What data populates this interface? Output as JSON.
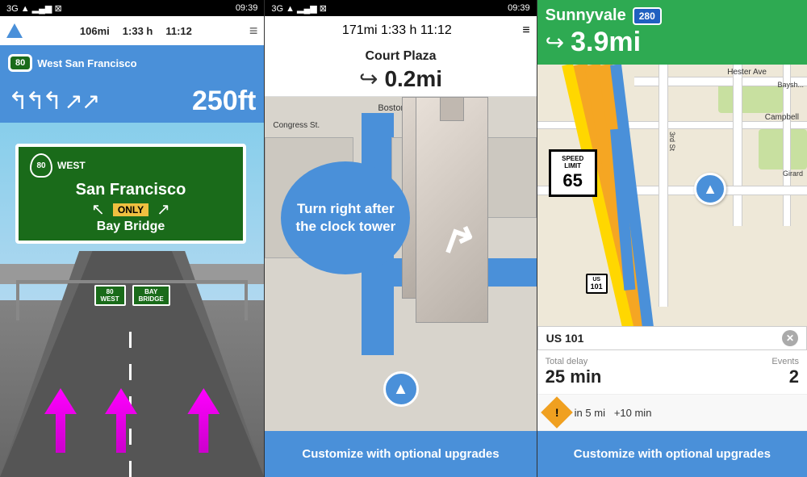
{
  "panel1": {
    "status_bar": {
      "signal": "3G",
      "time": "09:39",
      "signal_bars": "▂▄▆"
    },
    "header": {
      "distance": "106mi",
      "duration": "1:33 h",
      "eta": "11:12",
      "menu": "≡"
    },
    "direction_banner": {
      "shield_number": "80",
      "direction": "West",
      "destination": "San Francisco",
      "distance": "250ft",
      "arrows": "↰↰↰↗↗"
    },
    "road_sign": {
      "shield": "80",
      "direction": "WEST",
      "line1": "San Francisco",
      "line2": "Bay Bridge",
      "only": "ONLY"
    },
    "overhead_signs": [
      "",
      ""
    ]
  },
  "panel2": {
    "status_bar": {
      "signal": "3G",
      "time": "09:39"
    },
    "header": {
      "distance": "171mi",
      "duration": "1:33 h",
      "eta": "11:12",
      "menu": "≡"
    },
    "destination": "Court Plaza",
    "distance": "0.2mi",
    "bubble_text": "Turn right after the clock tower",
    "customize_label": "Customize with optional upgrades"
  },
  "panel3": {
    "city": "Sunnyvale",
    "highway": "280",
    "distance": "3.9mi",
    "road_labels": {
      "hester_ave": "Hester Ave",
      "bayshore": "Baysh...",
      "third_st": "3rd St",
      "campbell": "Campbell",
      "girard": "Girard",
      "us101": "US 101",
      "highway101": "101"
    },
    "traffic": {
      "total_delay_label": "Total delay",
      "events_label": "Events",
      "delay_value": "25 min",
      "events_value": "2"
    },
    "incident": {
      "distance": "in 5 mi",
      "delay": "+10 min"
    },
    "speed_limit": {
      "text": "SPEED\nLIMIT",
      "number": "65"
    },
    "customize_label": "Customize with optional upgrades"
  }
}
